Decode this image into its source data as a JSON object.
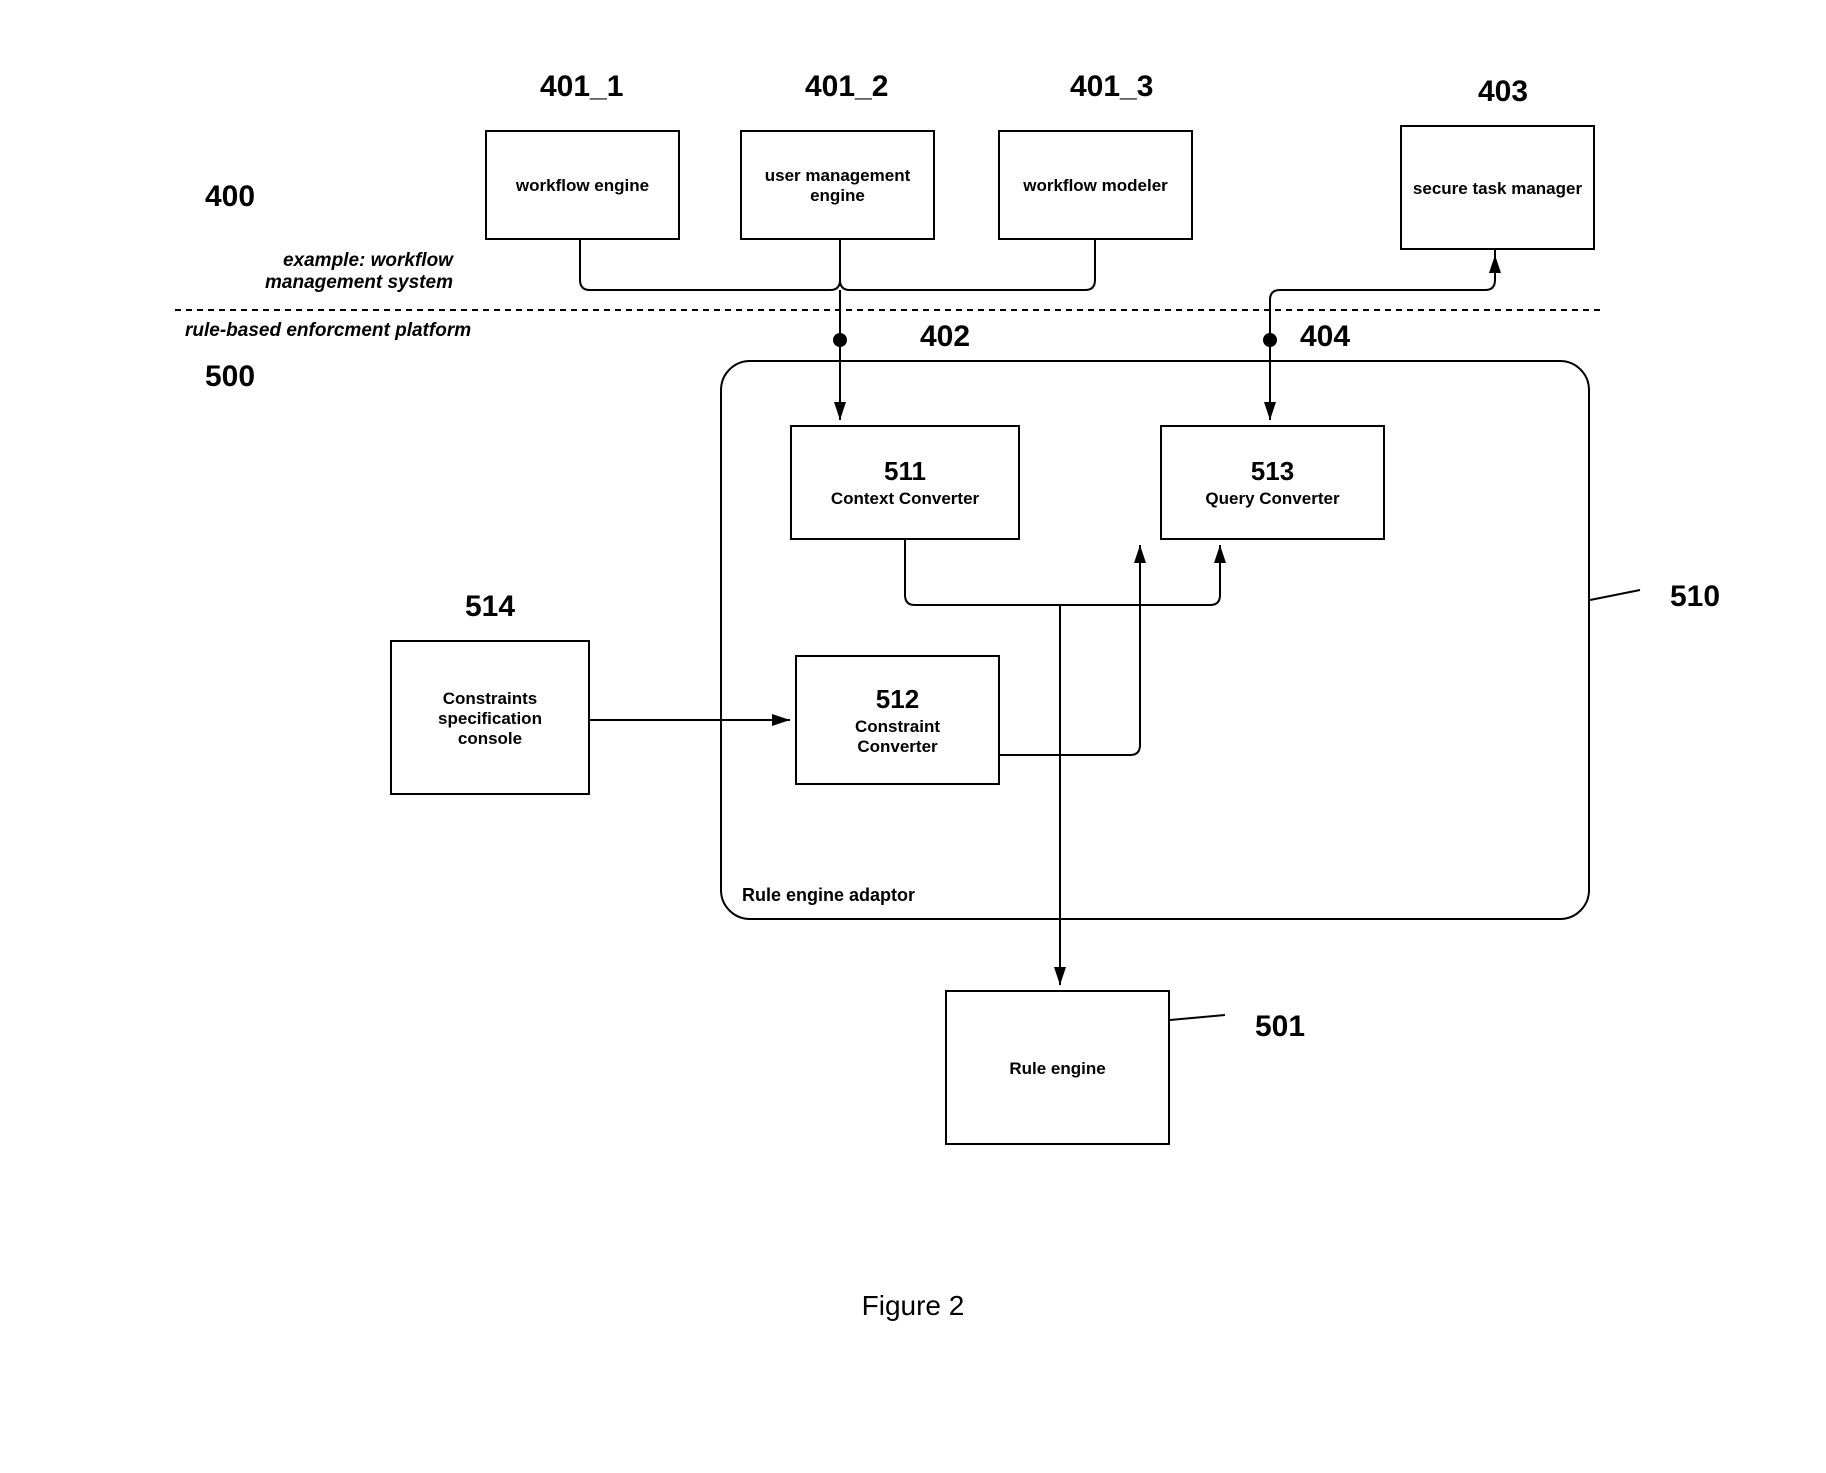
{
  "labels": {
    "ref_400": "400",
    "ref_401_1": "401_1",
    "ref_401_2": "401_2",
    "ref_401_3": "401_3",
    "ref_403": "403",
    "ref_402": "402",
    "ref_404": "404",
    "ref_500": "500",
    "ref_510": "510",
    "ref_511": "511",
    "ref_512": "512",
    "ref_513": "513",
    "ref_514": "514",
    "ref_501": "501",
    "section_top": "example: workflow\nmanagement system",
    "section_bottom": "rule-based enforcment platform"
  },
  "boxes": {
    "workflow_engine": "workflow engine",
    "user_mgmt_engine": "user management\nengine",
    "workflow_modeler": "workflow modeler",
    "secure_task_mgr": "secure task manager",
    "context_converter": "Context Converter",
    "query_converter": "Query Converter",
    "constraint_converter": "Constraint\nConverter",
    "constraints_console": "Constraints\nspecification\nconsole",
    "rule_engine_adaptor": "Rule engine adaptor",
    "rule_engine": "Rule engine"
  },
  "figure": "Figure 2"
}
